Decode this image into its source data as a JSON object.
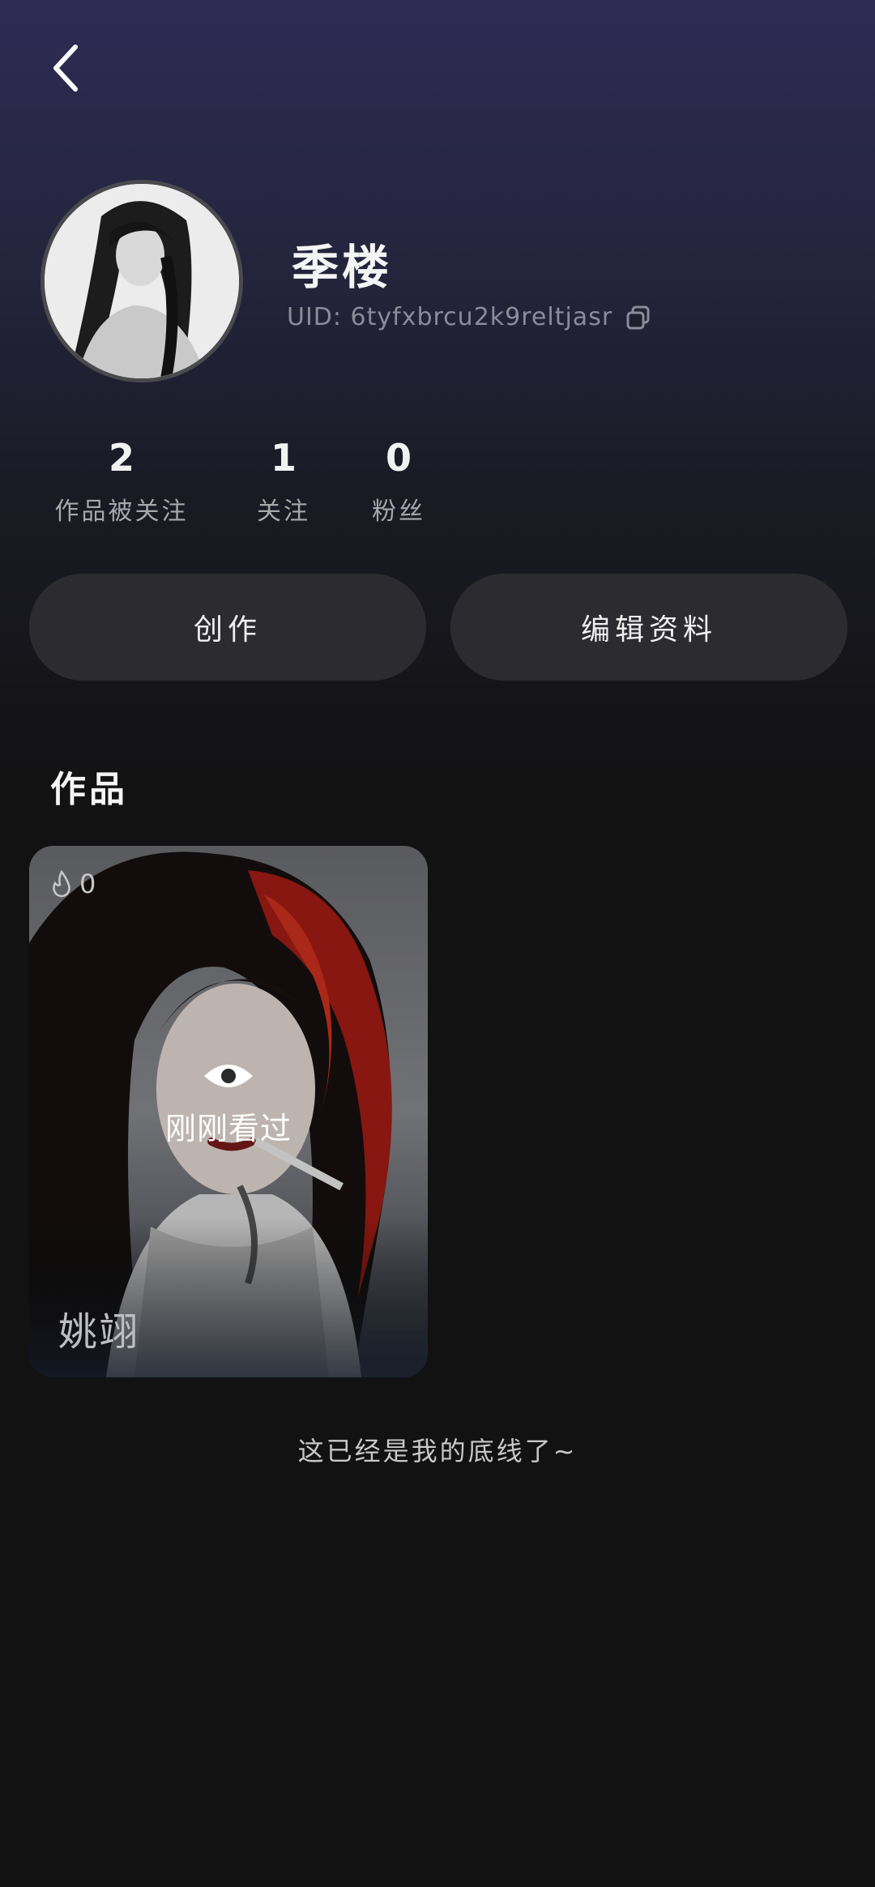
{
  "header": {
    "back_icon": "chevron-left-icon"
  },
  "profile": {
    "nickname": "季楼",
    "uid": "UID: 6tyfxbrcu2k9reltjasr",
    "copy_icon": "copy-icon"
  },
  "stats": [
    {
      "value": "2",
      "label": "作品被关注"
    },
    {
      "value": "1",
      "label": "关注"
    },
    {
      "value": "0",
      "label": "粉丝"
    }
  ],
  "actions": {
    "create_label": "创作",
    "edit_label": "编辑资料"
  },
  "works": {
    "title": "作品",
    "items": [
      {
        "likes": "0",
        "overlay_text": "刚刚看过",
        "name": "姚翊"
      }
    ]
  },
  "footer": {
    "text": "这已经是我的底线了~"
  },
  "colors": {
    "background": "#121212",
    "button": "#2c2c30",
    "header_gradient": "#2e2b54"
  }
}
